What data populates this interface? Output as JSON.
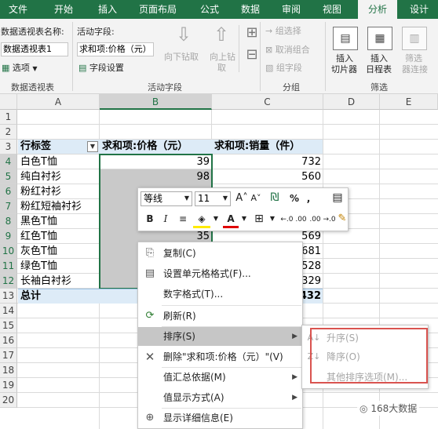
{
  "tabs": [
    "文件",
    "开始",
    "插入",
    "页面布局",
    "公式",
    "数据",
    "审阅",
    "视图",
    "分析",
    "设计"
  ],
  "active_tab": "分析",
  "ribbon": {
    "pt_name_label": "数据透视表名称:",
    "pt_name_value": "数据透视表1",
    "options": "选项",
    "group_pivot": "数据透视表",
    "active_field_label": "活动字段:",
    "active_field_value": "求和项:价格（元）",
    "field_settings": "字段设置",
    "drill_down": "向下钻取",
    "drill_up_1": "向上钻",
    "drill_up_2": "取",
    "group_active": "活动字段",
    "group_selection": "组选择",
    "ungroup": "取消组合",
    "group_field": "组字段",
    "group_group": "分组",
    "slicer_1": "插入",
    "slicer_2": "切片器",
    "timeline_1": "插入",
    "timeline_2": "日程表",
    "filter_conn_1": "筛选",
    "filter_conn_2": "器连接",
    "group_filter": "筛选"
  },
  "columns": [
    "A",
    "B",
    "C",
    "D",
    "E"
  ],
  "rows": [
    "1",
    "2",
    "3",
    "4",
    "5",
    "6",
    "7",
    "8",
    "9",
    "10",
    "11",
    "12",
    "13",
    "14",
    "15",
    "16",
    "17",
    "18",
    "19",
    "20"
  ],
  "pivot": {
    "hdr_a": "行标签",
    "hdr_b": "求和项:价格（元）",
    "hdr_c": "求和项:销量（件）",
    "labels": [
      "白色T恤",
      "纯白衬衫",
      "粉红衬衫",
      "粉红短袖衬衫",
      "黑色T恤",
      "红色T恤",
      "灰色T恤",
      "绿色T恤",
      "长袖白衬衫"
    ],
    "price_visible": [
      "39",
      "98",
      "35"
    ],
    "sales_visible": [
      "732",
      "560",
      "569",
      "681",
      "528",
      "329"
    ],
    "total_label": "总计",
    "total_sales": "432"
  },
  "mini_toolbar": {
    "font": "等线",
    "size": "11",
    "percent": "%",
    "comma": ",",
    "bold": "B",
    "italic": "I",
    "inc_decimal": "←.0 .00",
    "dec_decimal": ".00 →.0"
  },
  "context_menu": [
    "复制(C)",
    "设置单元格格式(F)...",
    "数字格式(T)...",
    "刷新(R)",
    "排序(S)",
    "删除\"求和项:价格（元）\"(V)",
    "值汇总依据(M)",
    "值显示方式(A)",
    "显示详细信息(E)"
  ],
  "submenu": [
    "升序(S)",
    "降序(O)",
    "其他排序选项(M)..."
  ],
  "watermark": "168大数据",
  "colors": {
    "excel_green": "#217346",
    "highlight": "#c6c6c6",
    "submenu_frame": "#d9534f"
  }
}
